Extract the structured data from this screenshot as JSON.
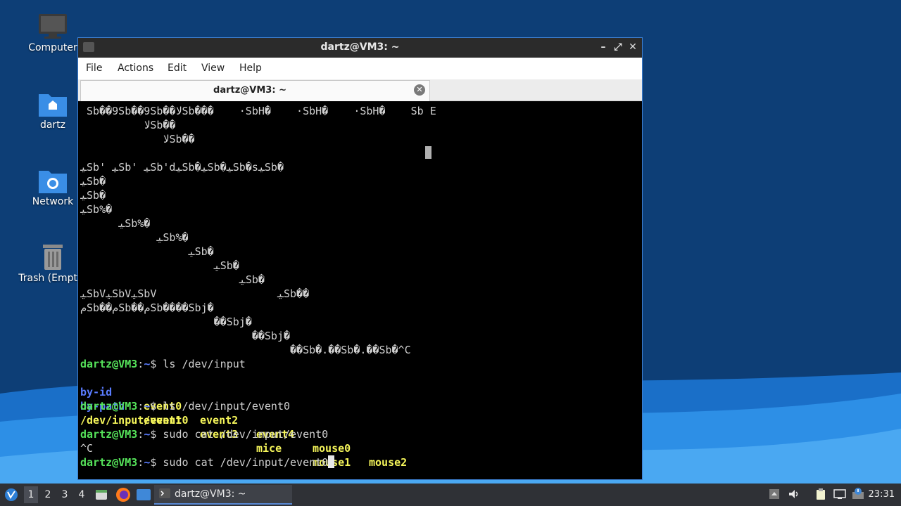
{
  "desktop": {
    "icons": [
      {
        "label": "Computer"
      },
      {
        "label": "dartz"
      },
      {
        "label": "Network"
      },
      {
        "label": "Trash (Empty)"
      }
    ]
  },
  "window": {
    "title": "dartz@VM3: ~",
    "menu": [
      "File",
      "Actions",
      "Edit",
      "View",
      "Help"
    ],
    "tab_label": "dartz@VM3: ~",
    "controls": {
      "minimize": "–",
      "maximize": "⤢",
      "close": "✕"
    }
  },
  "terminal": {
    "garbage": [
      " Sb��9Sb��9Sb��ﻻSb���    ·SbH�    ·SbH�    ·SbH�    Sb E",
      "          ﻻSb��",
      "             ﻻSb��",
      "",
      "ﻴSb' ﻴSb' ﻴSb'dﻴSb�ﻴSb�ﻴSb�sﻴSb�",
      "ﻴSb�",
      "ﻴSb�",
      "ﻴSb%�",
      "      ﻴSb%�",
      "            ﻴSb%�",
      "                 ﻴSb�",
      "                     ﻴSb�",
      "                         ﻴSb�",
      "ﻴSbVﻴSbVﻴSbV                   ﻴSb��",
      "ﻡSb��ﻡSb��ﻡSb����Sbj�",
      "                     ��Sbj�",
      "                           ��Sbj�",
      "                                 ��Sb�.��Sb�.��Sb�^C"
    ],
    "prompt_user": "dartz@VM3",
    "prompt_sep": ":",
    "prompt_path": "~",
    "prompt_dollar": "$ ",
    "cmd1": "ls /dev/input",
    "ls_row1": {
      "c1": "by-id",
      "c2": "event0",
      "c3": "event2",
      "c4": "event4",
      "c5": "mouse0",
      "c6": "mouse2"
    },
    "ls_row2": {
      "c1": "by-path",
      "c2": "event1",
      "c3": "event3",
      "c4": "mice",
      "c5": "mouse1"
    },
    "cmd2": "ls /dev/input/event0",
    "out2": "/dev/input/event0",
    "cmd3": "sudo cat /dev/input/event0",
    "out3": "^C",
    "cmd4": "sudo cat /dev/input/event0"
  },
  "taskbar": {
    "workspaces": [
      "1",
      "2",
      "3",
      "4"
    ],
    "task_label": "dartz@VM3: ~",
    "clock": "23:31"
  },
  "colors": {
    "prompt_green": "#55e25a",
    "dir_blue": "#5a7cff",
    "file_yellow": "#f5f55a",
    "window_border": "#3d7fd1"
  }
}
